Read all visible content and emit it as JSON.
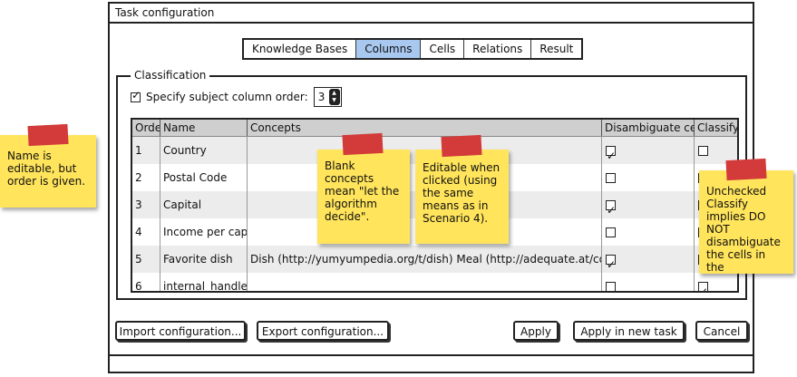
{
  "window": {
    "title": "Task configuration"
  },
  "tabs": [
    {
      "label": "Knowledge Bases",
      "active": false
    },
    {
      "label": "Columns",
      "active": true
    },
    {
      "label": "Cells",
      "active": false
    },
    {
      "label": "Relations",
      "active": false
    },
    {
      "label": "Result",
      "active": false
    }
  ],
  "classification": {
    "legend": "Classification",
    "specify_order_label": "Specify subject column order:",
    "specify_order_checked": true,
    "subject_column": "3"
  },
  "table": {
    "headers": [
      "Order",
      "Name",
      "Concepts",
      "Disambiguate cells",
      "Classify"
    ],
    "rows": [
      {
        "order": "1",
        "name": "Country",
        "concepts": "",
        "disambiguate": true,
        "classify": false
      },
      {
        "order": "2",
        "name": "Postal Code",
        "concepts": "",
        "disambiguate": false,
        "classify": false
      },
      {
        "order": "3",
        "name": "Capital",
        "concepts": "",
        "disambiguate": true,
        "classify": false
      },
      {
        "order": "4",
        "name": "Income per capita",
        "concepts": "",
        "disambiguate": false,
        "classify": true
      },
      {
        "order": "5",
        "name": "Favorite dish",
        "concepts": "Dish (http://yumyumpedia.org/t/dish) Meal (http://adequate.at/co",
        "disambiguate": true,
        "classify": false
      },
      {
        "order": "6",
        "name": "internal_handle",
        "concepts": "",
        "disambiguate": false,
        "classify": true
      }
    ]
  },
  "buttons": {
    "import": "Import configuration...",
    "export": "Export configuration...",
    "apply": "Apply",
    "apply_new": "Apply in new task",
    "cancel": "Cancel"
  },
  "notes": {
    "name_editable": "Name is editable, but order is given.",
    "blank_concepts": "Blank concepts mean \"let the algorithm decide\".",
    "editable_clicked": "Editable when clicked (using the same means as in Scenario 4).",
    "unchecked_classify": "Unchecked Classify implies DO NOT disambiguate the cells in the"
  },
  "colors": {
    "active_tab": "#a9c8f0",
    "sticky_note": "#ffe45c",
    "tape": "#d33a3a"
  }
}
